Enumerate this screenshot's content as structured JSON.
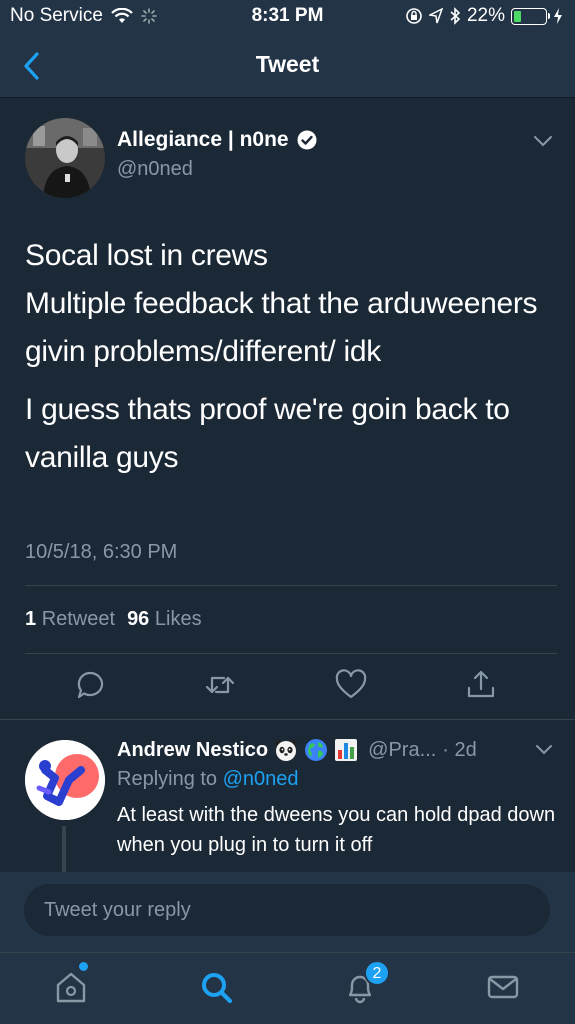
{
  "status_bar": {
    "carrier": "No Service",
    "time": "8:31 PM",
    "battery": "22%",
    "battery_level": 0.22,
    "icons": [
      "wifi-icon",
      "loading-icon",
      "lock-rotation-icon",
      "location-icon",
      "bluetooth-icon",
      "battery-icon",
      "charging-icon"
    ]
  },
  "nav": {
    "title": "Tweet",
    "back_icon": "chevron-left-icon"
  },
  "tweet": {
    "author_name": "Allegiance | n0ne",
    "verified_icon": "verified-badge-icon",
    "handle": "@n0ned",
    "paragraphs": [
      "Socal lost in crews\nMultiple feedback that the arduweeners givin problems/different/ idk",
      "I guess thats proof we're goin back to vanilla guys"
    ],
    "timestamp": "10/5/18, 6:30 PM",
    "retweet_count": "1",
    "retweet_label": "Retweet",
    "like_count": "96",
    "like_label": "Likes",
    "actions": [
      "reply-icon",
      "retweet-icon",
      "like-icon",
      "share-icon"
    ]
  },
  "reply": {
    "name": "Andrew Nestico",
    "emojis": [
      "panda-emoji-icon",
      "globe-emoji-icon",
      "bar-chart-emoji-icon"
    ],
    "handle": "@Pra...",
    "age": "· 2d",
    "replying_prefix": "Replying to",
    "replying_to": "@n0ned",
    "text": "At least with the dweens you can hold dpad down when you plug in to turn it off"
  },
  "compose": {
    "placeholder": "Tweet your reply"
  },
  "tab_bar": {
    "items": [
      "home-icon",
      "search-icon",
      "notifications-icon",
      "messages-icon"
    ],
    "notification_badge": "2"
  },
  "colors": {
    "accent": "#1da1f2",
    "background": "#1b2836",
    "bar": "#243447",
    "muted": "#8899a6"
  }
}
